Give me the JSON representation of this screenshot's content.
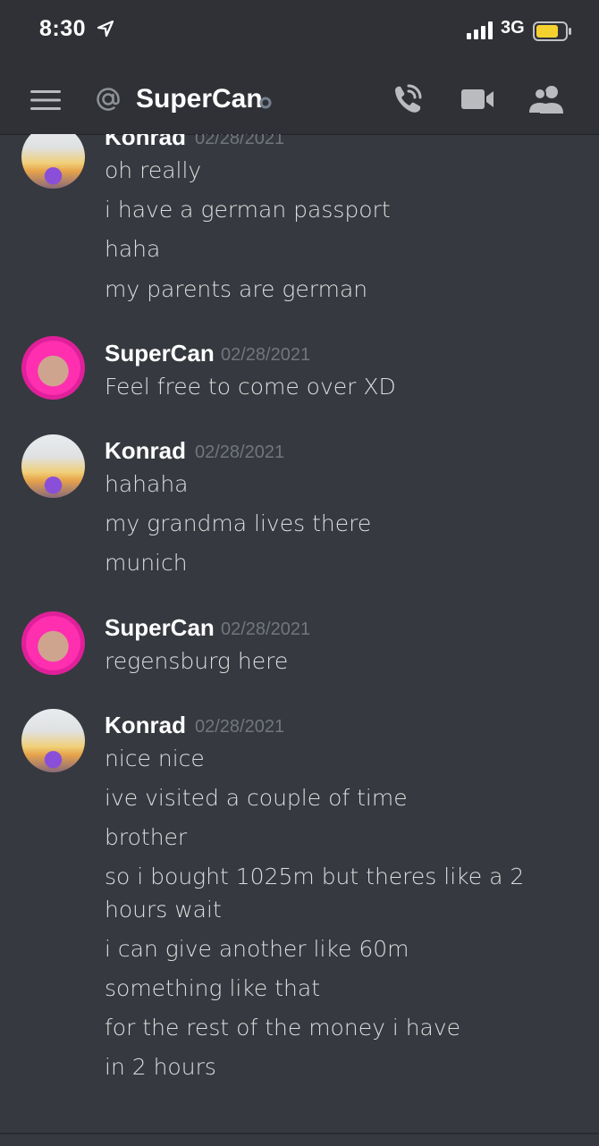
{
  "status_bar": {
    "time": "8:30",
    "network": "3G"
  },
  "header": {
    "channel_name": "SuperCan"
  },
  "messages": [
    {
      "author": "Konrad",
      "timestamp": "02/28/2021",
      "avatar": "konrad",
      "lines": [
        "oh really",
        "i have a german passport",
        "haha",
        "my parents are german"
      ]
    },
    {
      "author": "SuperCan",
      "timestamp": "02/28/2021",
      "avatar": "supercan",
      "lines": [
        "Feel free to come over XD"
      ]
    },
    {
      "author": "Konrad",
      "timestamp": "02/28/2021",
      "avatar": "konrad",
      "lines": [
        "hahaha",
        "my grandma lives there",
        "munich"
      ]
    },
    {
      "author": "SuperCan",
      "timestamp": "02/28/2021",
      "avatar": "supercan",
      "lines": [
        "regensburg here"
      ]
    },
    {
      "author": "Konrad",
      "timestamp": "02/28/2021",
      "avatar": "konrad",
      "lines": [
        "nice nice",
        "ive visited a couple of time",
        "brother",
        "so i bought 1025m but theres like a 2 hours wait",
        "i can give another like 60m",
        "something like that",
        "for the rest of the money i have",
        "in 2 hours"
      ]
    }
  ],
  "colors": {
    "background": "#36393f",
    "header": "#2f3136",
    "timestamp": "#72767d",
    "battery": "#f5d130"
  },
  "icons": [
    "location-arrow-icon",
    "signal-icon",
    "battery-icon",
    "hamburger-icon",
    "at-icon",
    "status-dot-icon",
    "call-icon",
    "video-icon",
    "members-icon"
  ]
}
